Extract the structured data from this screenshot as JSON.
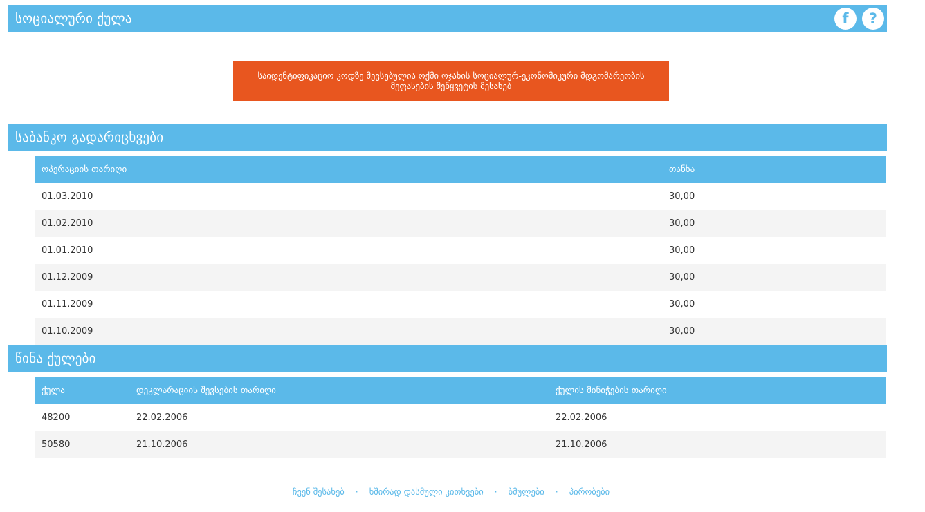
{
  "header": {
    "title": "სოციალური ქულა",
    "facebook_icon": "f",
    "help_icon": "?"
  },
  "notice": {
    "text": "საიდენტიფიკაციო კოდზე მევსებულია ოქმი ოჯახის სოციალურ-ეკონომიკური მდგომარეობის მეფასების მენყვეტის მესახებ"
  },
  "bank_section": {
    "title": "საბანკო გადარიცხვები",
    "columns": [
      "ოპერაციის თარიღი",
      "თანხა"
    ],
    "rows": [
      [
        "01.03.2010",
        "30,00"
      ],
      [
        "01.02.2010",
        "30,00"
      ],
      [
        "01.01.2010",
        "30,00"
      ],
      [
        "01.12.2009",
        "30,00"
      ],
      [
        "01.11.2009",
        "30,00"
      ],
      [
        "01.10.2009",
        "30,00"
      ]
    ]
  },
  "prev_section": {
    "title": "წინა ქულები",
    "columns": [
      "ქულა",
      "დეკლარაციის შევსების თარიღი",
      "ქულის მინიჭების თარიღი"
    ],
    "rows": [
      [
        "48200",
        "22.02.2006",
        "22.02.2006"
      ],
      [
        "50580",
        "21.10.2006",
        "21.10.2006"
      ]
    ]
  },
  "footer": {
    "links": [
      "ჩვენ შესახებ",
      "ხშირად დასმული კითხვები",
      "ბმულები",
      "პირობები"
    ],
    "separator": "·"
  },
  "colors": {
    "accent": "#5bb9e9",
    "notice": "#e8561f",
    "row_alt": "#f4f4f4"
  }
}
